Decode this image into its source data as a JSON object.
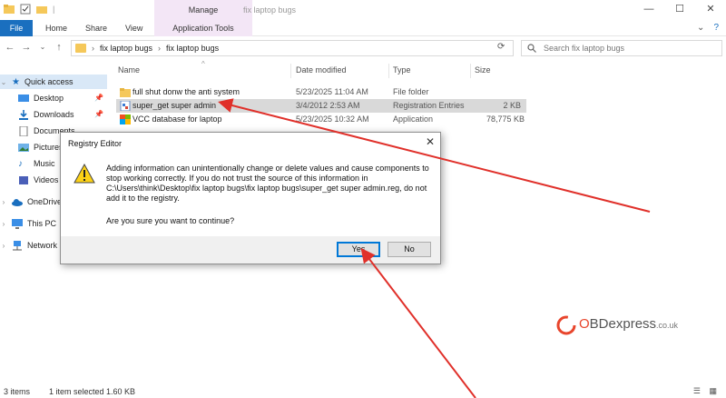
{
  "window": {
    "title": "fix laptop bugs",
    "manage_label": "Manage",
    "controls": [
      "—",
      "☐",
      "✕"
    ]
  },
  "ribbon": {
    "tabs": [
      "File",
      "Home",
      "Share",
      "View",
      "Application Tools"
    ]
  },
  "address": {
    "crumbs": [
      "fix laptop bugs",
      "fix laptop bugs"
    ],
    "search_placeholder": "Search fix laptop bugs"
  },
  "navpane": {
    "items": [
      {
        "label": "Quick access"
      },
      {
        "label": "Desktop"
      },
      {
        "label": "Downloads"
      },
      {
        "label": "Documents"
      },
      {
        "label": "Pictures"
      },
      {
        "label": "Music"
      },
      {
        "label": "Videos"
      },
      {
        "label": "OneDrive"
      },
      {
        "label": "This PC"
      },
      {
        "label": "Network"
      }
    ]
  },
  "filelist": {
    "columns": [
      "Name",
      "Date modified",
      "Type",
      "Size"
    ],
    "rows": [
      {
        "name": "full shut donw the anti system",
        "date": "5/23/2025 11:04 AM",
        "type": "File folder",
        "size": ""
      },
      {
        "name": "super_get super admin",
        "date": "3/4/2012 2:53 AM",
        "type": "Registration Entries",
        "size": "2 KB"
      },
      {
        "name": "VCC database for laptop",
        "date": "5/23/2025 10:32 AM",
        "type": "Application",
        "size": "78,775 KB"
      }
    ]
  },
  "status": {
    "items": "3 items",
    "selected": "1 item selected  1.60 KB"
  },
  "dialog": {
    "title": "Registry Editor",
    "close": "✕",
    "message": "Adding information can unintentionally change or delete values and cause components to stop working correctly. If you do not trust the source of this information in C:\\Users\\think\\Desktop\\fix laptop bugs\\fix laptop bugs\\super_get super admin.reg, do not add it to the registry.",
    "question": "Are you sure you want to continue?",
    "yes": "Yes",
    "no": "No"
  },
  "watermark": {
    "brand_o": "O",
    "brand_rest": "BDexpress",
    "suffix": ".co.uk"
  },
  "colors": {
    "file_tab": "#1a6fbf",
    "manage_tab": "#f3e6f6",
    "arrow": "#e0302a",
    "folder": "#f5c85a"
  }
}
